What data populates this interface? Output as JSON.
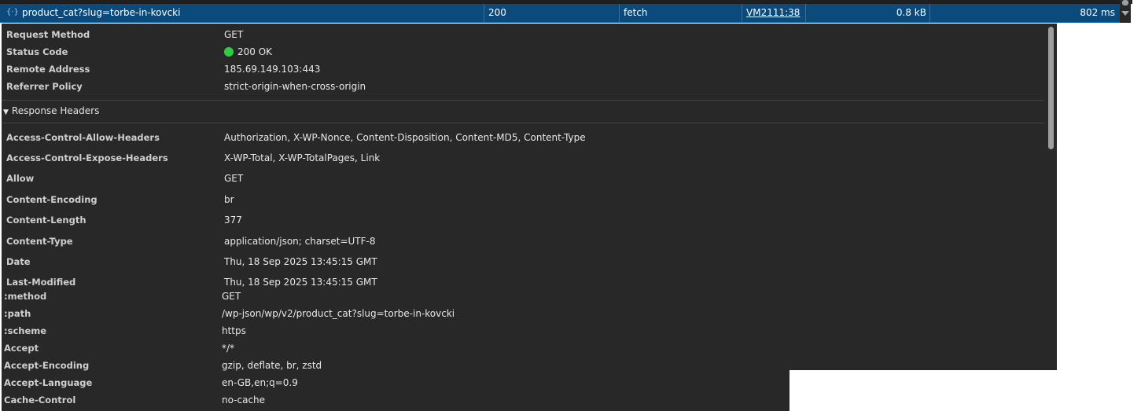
{
  "request_row": {
    "name": "product_cat?slug=torbe-in-kovcki",
    "status": "200",
    "type": "fetch",
    "initiator": "VM2111:38",
    "size": "0.8 kB",
    "time": "802 ms"
  },
  "general": [
    {
      "key": "Request Method",
      "value": "GET"
    },
    {
      "key": "Status Code",
      "value": "200 OK"
    },
    {
      "key": "Remote Address",
      "value": "185.69.149.103:443"
    },
    {
      "key": "Referrer Policy",
      "value": "strict-origin-when-cross-origin"
    }
  ],
  "response_headers": {
    "title": "Response Headers",
    "items": [
      {
        "key": "Access-Control-Allow-Headers",
        "value": "Authorization, X-WP-Nonce, Content-Disposition, Content-MD5, Content-Type"
      },
      {
        "key": "Access-Control-Expose-Headers",
        "value": "X-WP-Total, X-WP-TotalPages, Link"
      },
      {
        "key": "Allow",
        "value": "GET"
      },
      {
        "key": "Content-Encoding",
        "value": "br"
      },
      {
        "key": "Content-Length",
        "value": "377"
      },
      {
        "key": "Content-Type",
        "value": "application/json; charset=UTF-8"
      },
      {
        "key": "Date",
        "value": "Thu, 18 Sep 2025 13:45:15 GMT"
      },
      {
        "key": "Last-Modified",
        "value": "Thu, 18 Sep 2025 13:45:15 GMT"
      }
    ]
  },
  "request_headers": [
    {
      "key": ":method",
      "value": "GET"
    },
    {
      "key": ":path",
      "value": "/wp-json/wp/v2/product_cat?slug=torbe-in-kovcki"
    },
    {
      "key": ":scheme",
      "value": "https"
    },
    {
      "key": "Accept",
      "value": "*/*"
    },
    {
      "key": "Accept-Encoding",
      "value": "gzip, deflate, br, zstd"
    },
    {
      "key": "Accept-Language",
      "value": "en-GB,en;q=0.9"
    },
    {
      "key": "Cache-Control",
      "value": "no-cache"
    }
  ],
  "colors": {
    "panel_bg": "#282828",
    "selected_row": "#0b4a7a",
    "status_ok": "#2ecc40"
  },
  "icons": {
    "request_type": "fetch-braces-icon",
    "section_toggle": "triangle-down-icon"
  }
}
